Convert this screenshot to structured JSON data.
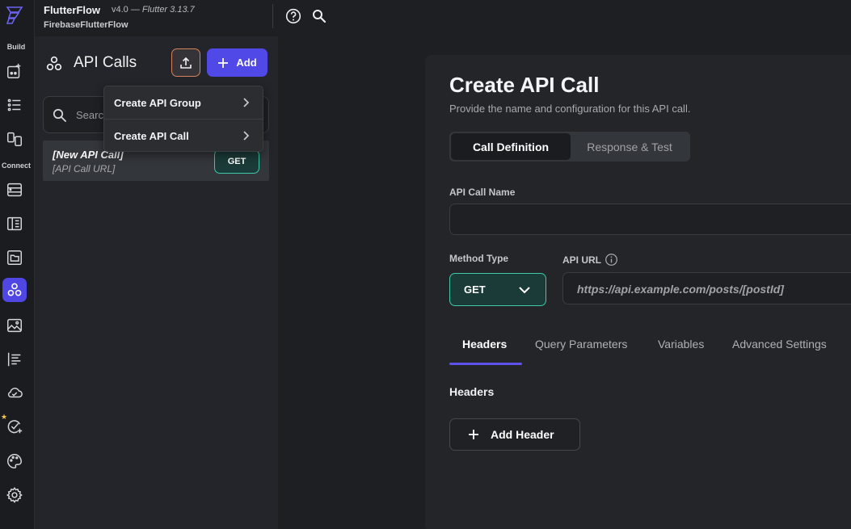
{
  "app": {
    "name": "FlutterFlow",
    "version": "v4.0",
    "flutter": "Flutter 3.13.7",
    "project": "FirebaseFlutterFlow"
  },
  "rail": {
    "build_label": "Build",
    "connect_label": "Connect",
    "icons": [
      "add-widget-icon",
      "list-icon",
      "storyboard-icon",
      "database-icon",
      "table-icon",
      "folder-icon",
      "api-icon",
      "media-icon",
      "theme-text-icon",
      "cloud-icon",
      "agent-check-icon",
      "palette-icon",
      "settings-icon"
    ]
  },
  "panel": {
    "title": "API Calls",
    "add_label": "Add",
    "search_placeholder": "Search",
    "items": [
      {
        "name": "[New API Call]",
        "url": "[API Call URL]",
        "method": "GET"
      }
    ]
  },
  "menu": {
    "items": [
      "Create API Group",
      "Create API Call"
    ]
  },
  "main": {
    "title": "Create API Call",
    "subtitle": "Provide the name and configuration for this API call.",
    "segments": [
      "Call Definition",
      "Response & Test"
    ],
    "name_label": "API Call Name",
    "name_value": "",
    "method_label": "Method Type",
    "method_value": "GET",
    "url_label": "API URL",
    "url_placeholder": "https://api.example.com/posts/[postId]",
    "tabs": [
      "Headers",
      "Query Parameters",
      "Variables",
      "Advanced Settings"
    ],
    "headers_label": "Headers",
    "add_header_label": "Add Header"
  },
  "colors": {
    "accent": "#5148e8",
    "method_green": "#3ecaa8",
    "upload_orange": "#d4845a"
  }
}
